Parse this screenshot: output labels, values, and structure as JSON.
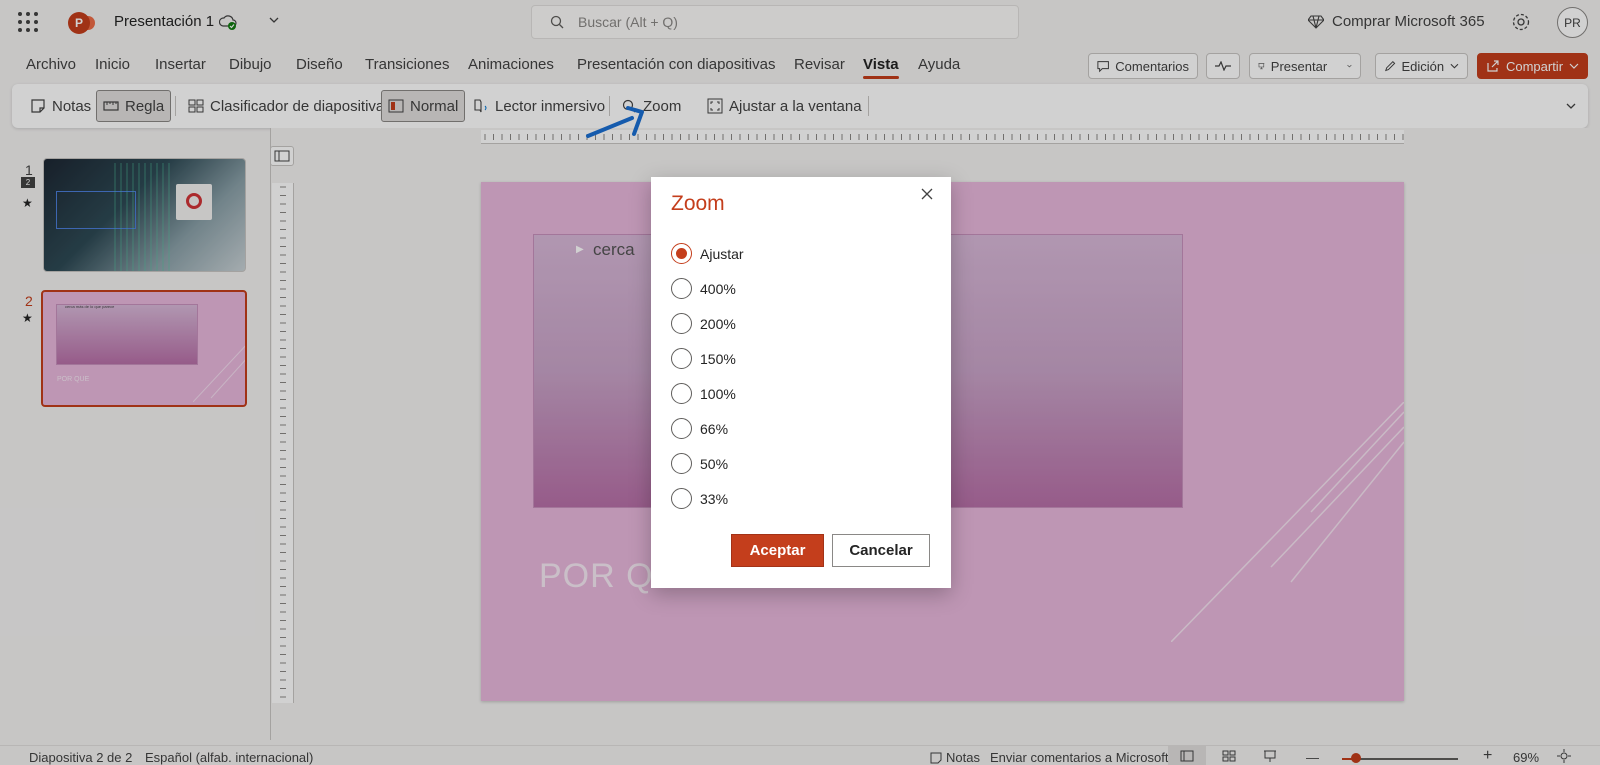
{
  "app": {
    "title": "Presentación 1",
    "search_placeholder": "Buscar (Alt + Q)",
    "buy_label": "Comprar Microsoft 365",
    "avatar_initials": "PR",
    "logo_letter": "P"
  },
  "menu": {
    "tabs": [
      "Archivo",
      "Inicio",
      "Insertar",
      "Dibujo",
      "Diseño",
      "Transiciones",
      "Animaciones",
      "Presentación con diapositivas",
      "Revisar",
      "Vista",
      "Ayuda"
    ],
    "active_tab": "Vista",
    "comments_label": "Comentarios",
    "present_label": "Presentar",
    "edit_label": "Edición",
    "share_label": "Compartir"
  },
  "ribbon": {
    "notes": "Notas",
    "ruler": "Regla",
    "sorter": "Clasificador de diapositivas",
    "normal": "Normal",
    "reader": "Lector inmersivo",
    "zoom": "Zoom",
    "fit": "Ajustar a la ventana"
  },
  "thumbnails": {
    "slide1_num": "1",
    "slide1_comments": "2",
    "slide2_num": "2",
    "slide2_text": "POR QUE",
    "slide2_header": "cerca más de lo que parece"
  },
  "slide": {
    "bullet": "cerca",
    "title": "POR QUE"
  },
  "dialog": {
    "title": "Zoom",
    "options": [
      "Ajustar",
      "400%",
      "200%",
      "150%",
      "100%",
      "66%",
      "50%",
      "33%"
    ],
    "selected": "Ajustar",
    "ok": "Aceptar",
    "cancel": "Cancelar"
  },
  "status": {
    "slide_info": "Diapositiva 2 de 2",
    "language": "Español (alfab. internacional)",
    "notes": "Notas",
    "feedback": "Enviar comentarios a Microsoft",
    "zoom": "69%",
    "zoom_fraction": 0.12
  },
  "colors": {
    "accent": "#c43e1c",
    "slide_bg": "#e8b7dc"
  }
}
